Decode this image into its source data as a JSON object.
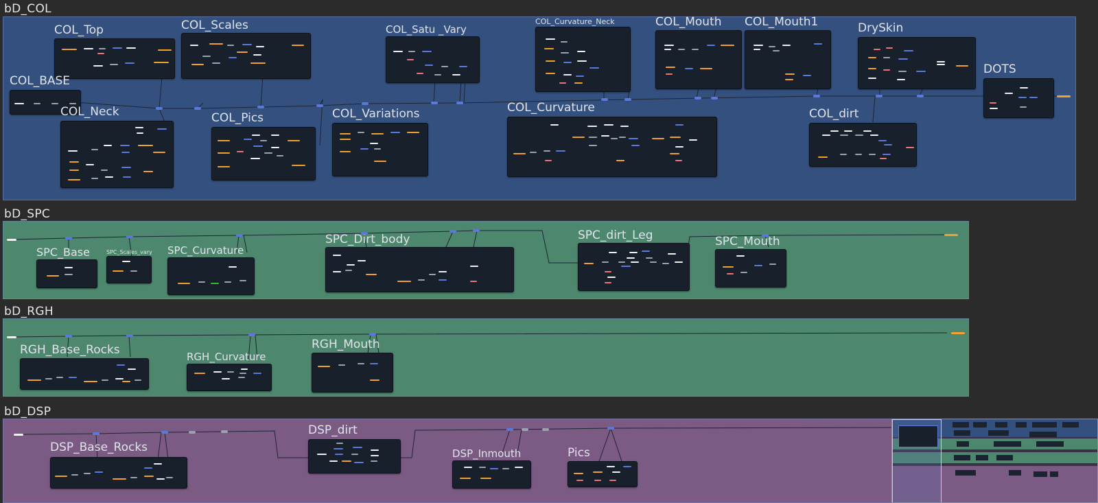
{
  "frames": {
    "col": {
      "title": "bD_COL",
      "color": "#34507f"
    },
    "spc": {
      "title": "bD_SPC",
      "color": "#4d876d"
    },
    "rgh": {
      "title": "bD_RGH",
      "color": "#4d876d"
    },
    "dsp": {
      "title": "bD_DSP",
      "color": "#7b5b84"
    }
  },
  "nodes": {
    "col_top": "COL_Top",
    "col_scales": "COL_Scales",
    "col_satu_vary": "COL_Satu _Vary",
    "col_curvature_neck": "COL_Curvature_Neck",
    "col_mouth": "COL_Mouth",
    "col_mouth1": "COL_Mouth1",
    "dryskin": "DrySkin",
    "col_base": "COL_BASE",
    "dots": "DOTS",
    "col_neck": "COL_Neck",
    "col_pics": "COL_Pics",
    "col_variations": "COL_Variations",
    "col_curvature": "COL_Curvature",
    "col_dirt": "COL_dirt",
    "spc_base": "SPC_Base",
    "spc_scales_vary": "SPC_Scales_vary",
    "spc_curvature": "SPC_Curvature",
    "spc_dirt_body": "SPC_Dirt_body",
    "spc_dirt_leg": "SPC_dirt_Leg",
    "spc_mouth": "SPC_Mouth",
    "rgh_base_rocks": "RGH_Base_Rocks",
    "rgh_curvature": "RGH_Curvature",
    "rgh_mouth": "RGH_Mouth",
    "dsp_base_rocks": "DSP_Base_Rocks",
    "dsp_dirt": "DSP_dirt",
    "dsp_inmouth": "DSP_Inmouth",
    "pics": "Pics"
  },
  "socket_colors": {
    "float": "#f2a12e",
    "color": "#eef0f2",
    "vector": "#5b79db",
    "shader": "#f07373",
    "green": "#2ec12e"
  }
}
